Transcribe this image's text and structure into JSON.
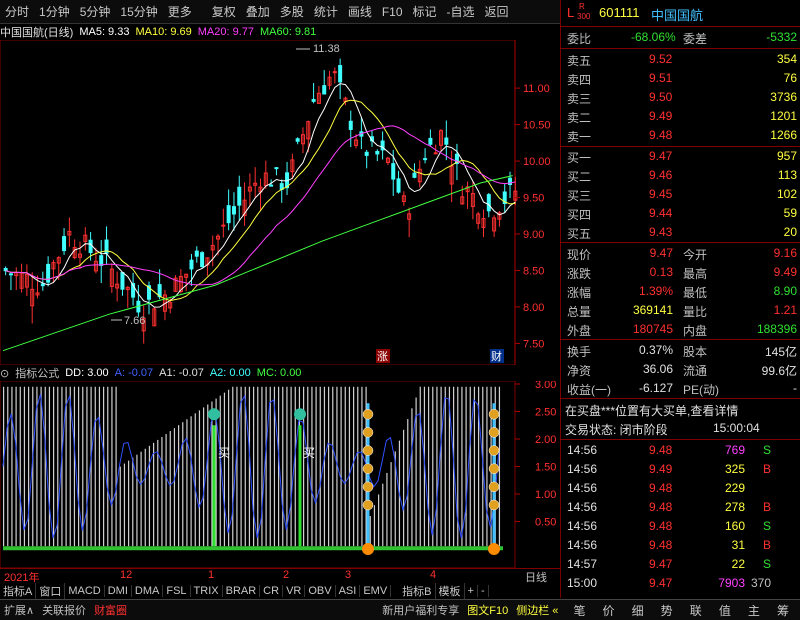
{
  "toolbar": {
    "items": [
      "分时",
      "1分钟",
      "5分钟",
      "15分钟",
      "更多",
      "复权",
      "叠加",
      "多股",
      "统计",
      "画线",
      "F10",
      "标记",
      "-自选",
      "返回"
    ]
  },
  "chart_title": {
    "name": "中国国航(日线)",
    "ma5": "MA5: 9.33",
    "ma10": "MA10: 9.69",
    "ma20": "MA20: 9.77",
    "ma60": "MA60: 9.81"
  },
  "price_axis": [
    "11.00",
    "10.50",
    "10.00",
    "9.50",
    "9.00",
    "8.50",
    "8.00",
    "7.50"
  ],
  "annotations": {
    "high": "11.38",
    "low": "7.66",
    "zhang": "涨",
    "cai": "财"
  },
  "indicator_title": {
    "name": "指标公式",
    "dd": "DD: 3.00",
    "a": "A: -0.07",
    "a1": "A1: -0.07",
    "a2": "A2: 0.00",
    "mc": "MC: 0.00"
  },
  "indicator_axis": [
    "3.00",
    "2.50",
    "2.00",
    "1.50",
    "1.00",
    "0.50"
  ],
  "signal_label": "买",
  "date_axis": {
    "year": "2021年",
    "m12": "12",
    "m1": "1",
    "m2": "2",
    "m3": "3",
    "m4": "4",
    "period": "日线"
  },
  "tabs": [
    "指标A",
    "窗口",
    "MACD",
    "DMI",
    "DMA",
    "FSL",
    "TRIX",
    "BRAR",
    "CR",
    "VR",
    "OBV",
    "ASI",
    "EMV",
    "指标B",
    "模板",
    "+",
    "-"
  ],
  "status": {
    "expand": "扩展∧",
    "related": "关联报价",
    "wealth": "财富圈",
    "news": "新用户福利专享",
    "f10": "图文F10",
    "sidebar": "侧边栏 «"
  },
  "side_icons": [
    "笔",
    "价",
    "细",
    "势",
    "联",
    "值",
    "主",
    "筹"
  ],
  "quote": {
    "code": "601111",
    "name": "中国国航",
    "badge_l": "L",
    "badge_r": "R",
    "badge_n": "300",
    "weibi_label": "委比",
    "weibi": "-68.06%",
    "weicha_label": "委差",
    "weicha": "-5332",
    "asks": [
      {
        "label": "卖五",
        "price": "9.52",
        "vol": "354"
      },
      {
        "label": "卖四",
        "price": "9.51",
        "vol": "76"
      },
      {
        "label": "卖三",
        "price": "9.50",
        "vol": "3736"
      },
      {
        "label": "卖二",
        "price": "9.49",
        "vol": "1201"
      },
      {
        "label": "卖一",
        "price": "9.48",
        "vol": "1266"
      }
    ],
    "bids": [
      {
        "label": "买一",
        "price": "9.47",
        "vol": "957"
      },
      {
        "label": "买二",
        "price": "9.46",
        "vol": "113"
      },
      {
        "label": "买三",
        "price": "9.45",
        "vol": "102"
      },
      {
        "label": "买四",
        "price": "9.44",
        "vol": "59"
      },
      {
        "label": "买五",
        "price": "9.43",
        "vol": "20"
      }
    ],
    "stats": [
      {
        "l1": "现价",
        "v1": "9.47",
        "l2": "今开",
        "v2": "9.16",
        "c1": "#ff3030",
        "c2": "#ff3030"
      },
      {
        "l1": "涨跌",
        "v1": "0.13",
        "l2": "最高",
        "v2": "9.49",
        "c1": "#ff3030",
        "c2": "#ff3030"
      },
      {
        "l1": "涨幅",
        "v1": "1.39%",
        "l2": "最低",
        "v2": "8.90",
        "c1": "#ff3030",
        "c2": "#30e030"
      },
      {
        "l1": "总量",
        "v1": "369141",
        "l2": "量比",
        "v2": "1.21",
        "c1": "#ffff40",
        "c2": "#ff3030"
      },
      {
        "l1": "外盘",
        "v1": "180745",
        "l2": "内盘",
        "v2": "188396",
        "c1": "#ff3030",
        "c2": "#30e030"
      }
    ],
    "stats2": [
      {
        "l1": "换手",
        "v1": "0.37%",
        "l2": "股本",
        "v2": "145亿"
      },
      {
        "l1": "净资",
        "v1": "36.06",
        "l2": "流通",
        "v2": "99.6亿"
      },
      {
        "l1": "收益(一)",
        "v1": "-6.127",
        "l2": "PE(动)",
        "v2": "-"
      }
    ],
    "notice": "在买盘***位置有大买单,查看详情",
    "trade_state": "交易状态: 闭市阶段",
    "trade_time": "15:00:04",
    "ticks": [
      {
        "t": "14:56",
        "p": "9.48",
        "v": "769",
        "s": "S",
        "vc": "#ff40ff",
        "sc": "#30e030"
      },
      {
        "t": "14:56",
        "p": "9.49",
        "v": "325",
        "s": "B",
        "vc": "#ffff40",
        "sc": "#ff3030"
      },
      {
        "t": "14:56",
        "p": "9.48",
        "v": "229",
        "s": "",
        "vc": "#ffff40",
        "sc": "#ff3030"
      },
      {
        "t": "14:56",
        "p": "9.48",
        "v": "278",
        "s": "B",
        "vc": "#ffff40",
        "sc": "#ff3030"
      },
      {
        "t": "14:56",
        "p": "9.48",
        "v": "160",
        "s": "S",
        "vc": "#ffff40",
        "sc": "#30e030"
      },
      {
        "t": "14:56",
        "p": "9.48",
        "v": "31",
        "s": "B",
        "vc": "#ffff40",
        "sc": "#ff3030"
      },
      {
        "t": "14:57",
        "p": "9.47",
        "v": "22",
        "s": "S",
        "vc": "#ffff40",
        "sc": "#30e030"
      },
      {
        "t": "15:00",
        "p": "9.47",
        "v": "7903",
        "s": "370",
        "vc": "#ff40ff",
        "sc": "#c0c0c0"
      }
    ]
  },
  "colors": {
    "up": "#ff3030",
    "down": "#40ffff",
    "ma5": "#ffffff",
    "ma10": "#ffff40",
    "ma20": "#ff40ff",
    "ma60": "#40ff40",
    "grid": "#800000"
  }
}
